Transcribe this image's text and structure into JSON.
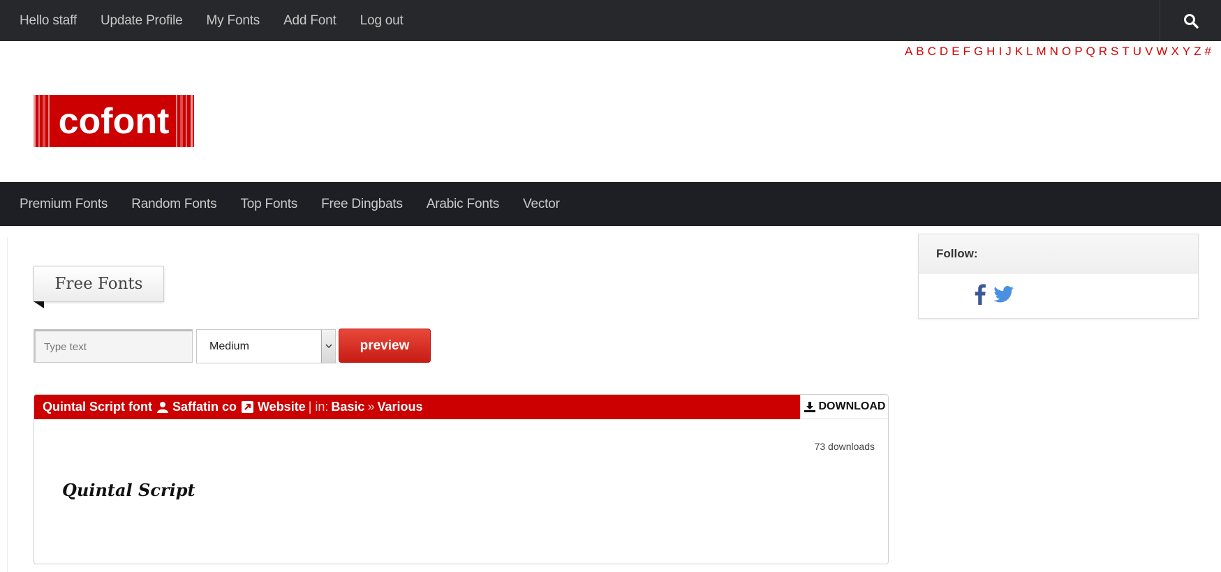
{
  "top_nav": {
    "items": [
      "Hello staff",
      "Update Profile",
      "My Fonts",
      "Add Font",
      "Log out"
    ],
    "search_icon": "search-icon"
  },
  "alphabet": [
    "A",
    "B",
    "C",
    "D",
    "E",
    "F",
    "G",
    "H",
    "I",
    "J",
    "K",
    "L",
    "M",
    "N",
    "O",
    "P",
    "Q",
    "R",
    "S",
    "T",
    "U",
    "V",
    "W",
    "X",
    "Y",
    "Z",
    "#"
  ],
  "logo": {
    "text": "cofont",
    "color": "#cc0000"
  },
  "category_nav": {
    "items": [
      "Premium Fonts",
      "Random Fonts",
      "Top Fonts",
      "Free Dingbats",
      "Arabic Fonts",
      "Vector"
    ]
  },
  "section": {
    "title": "Free Fonts"
  },
  "preview_form": {
    "text_placeholder": "Type text",
    "size_value": "Medium",
    "button_label": "preview"
  },
  "font_card": {
    "name": "Quintal Script font",
    "author": "Saffatin co",
    "website_label": "Website",
    "in_label": "| in:",
    "category": "Basic",
    "separator": "»",
    "subcategory": "Various",
    "download_label": "DOWNLOAD",
    "downloads": "73 downloads",
    "sample_text": "Quintal Script"
  },
  "sidebar": {
    "follow_title": "Follow:",
    "social": [
      "facebook-icon",
      "twitter-icon"
    ]
  },
  "colors": {
    "brand_red": "#cc0000",
    "topbar": "#27282b",
    "catbar": "#1e1f24",
    "facebook": "#3b5998",
    "twitter": "#4a90e2"
  }
}
